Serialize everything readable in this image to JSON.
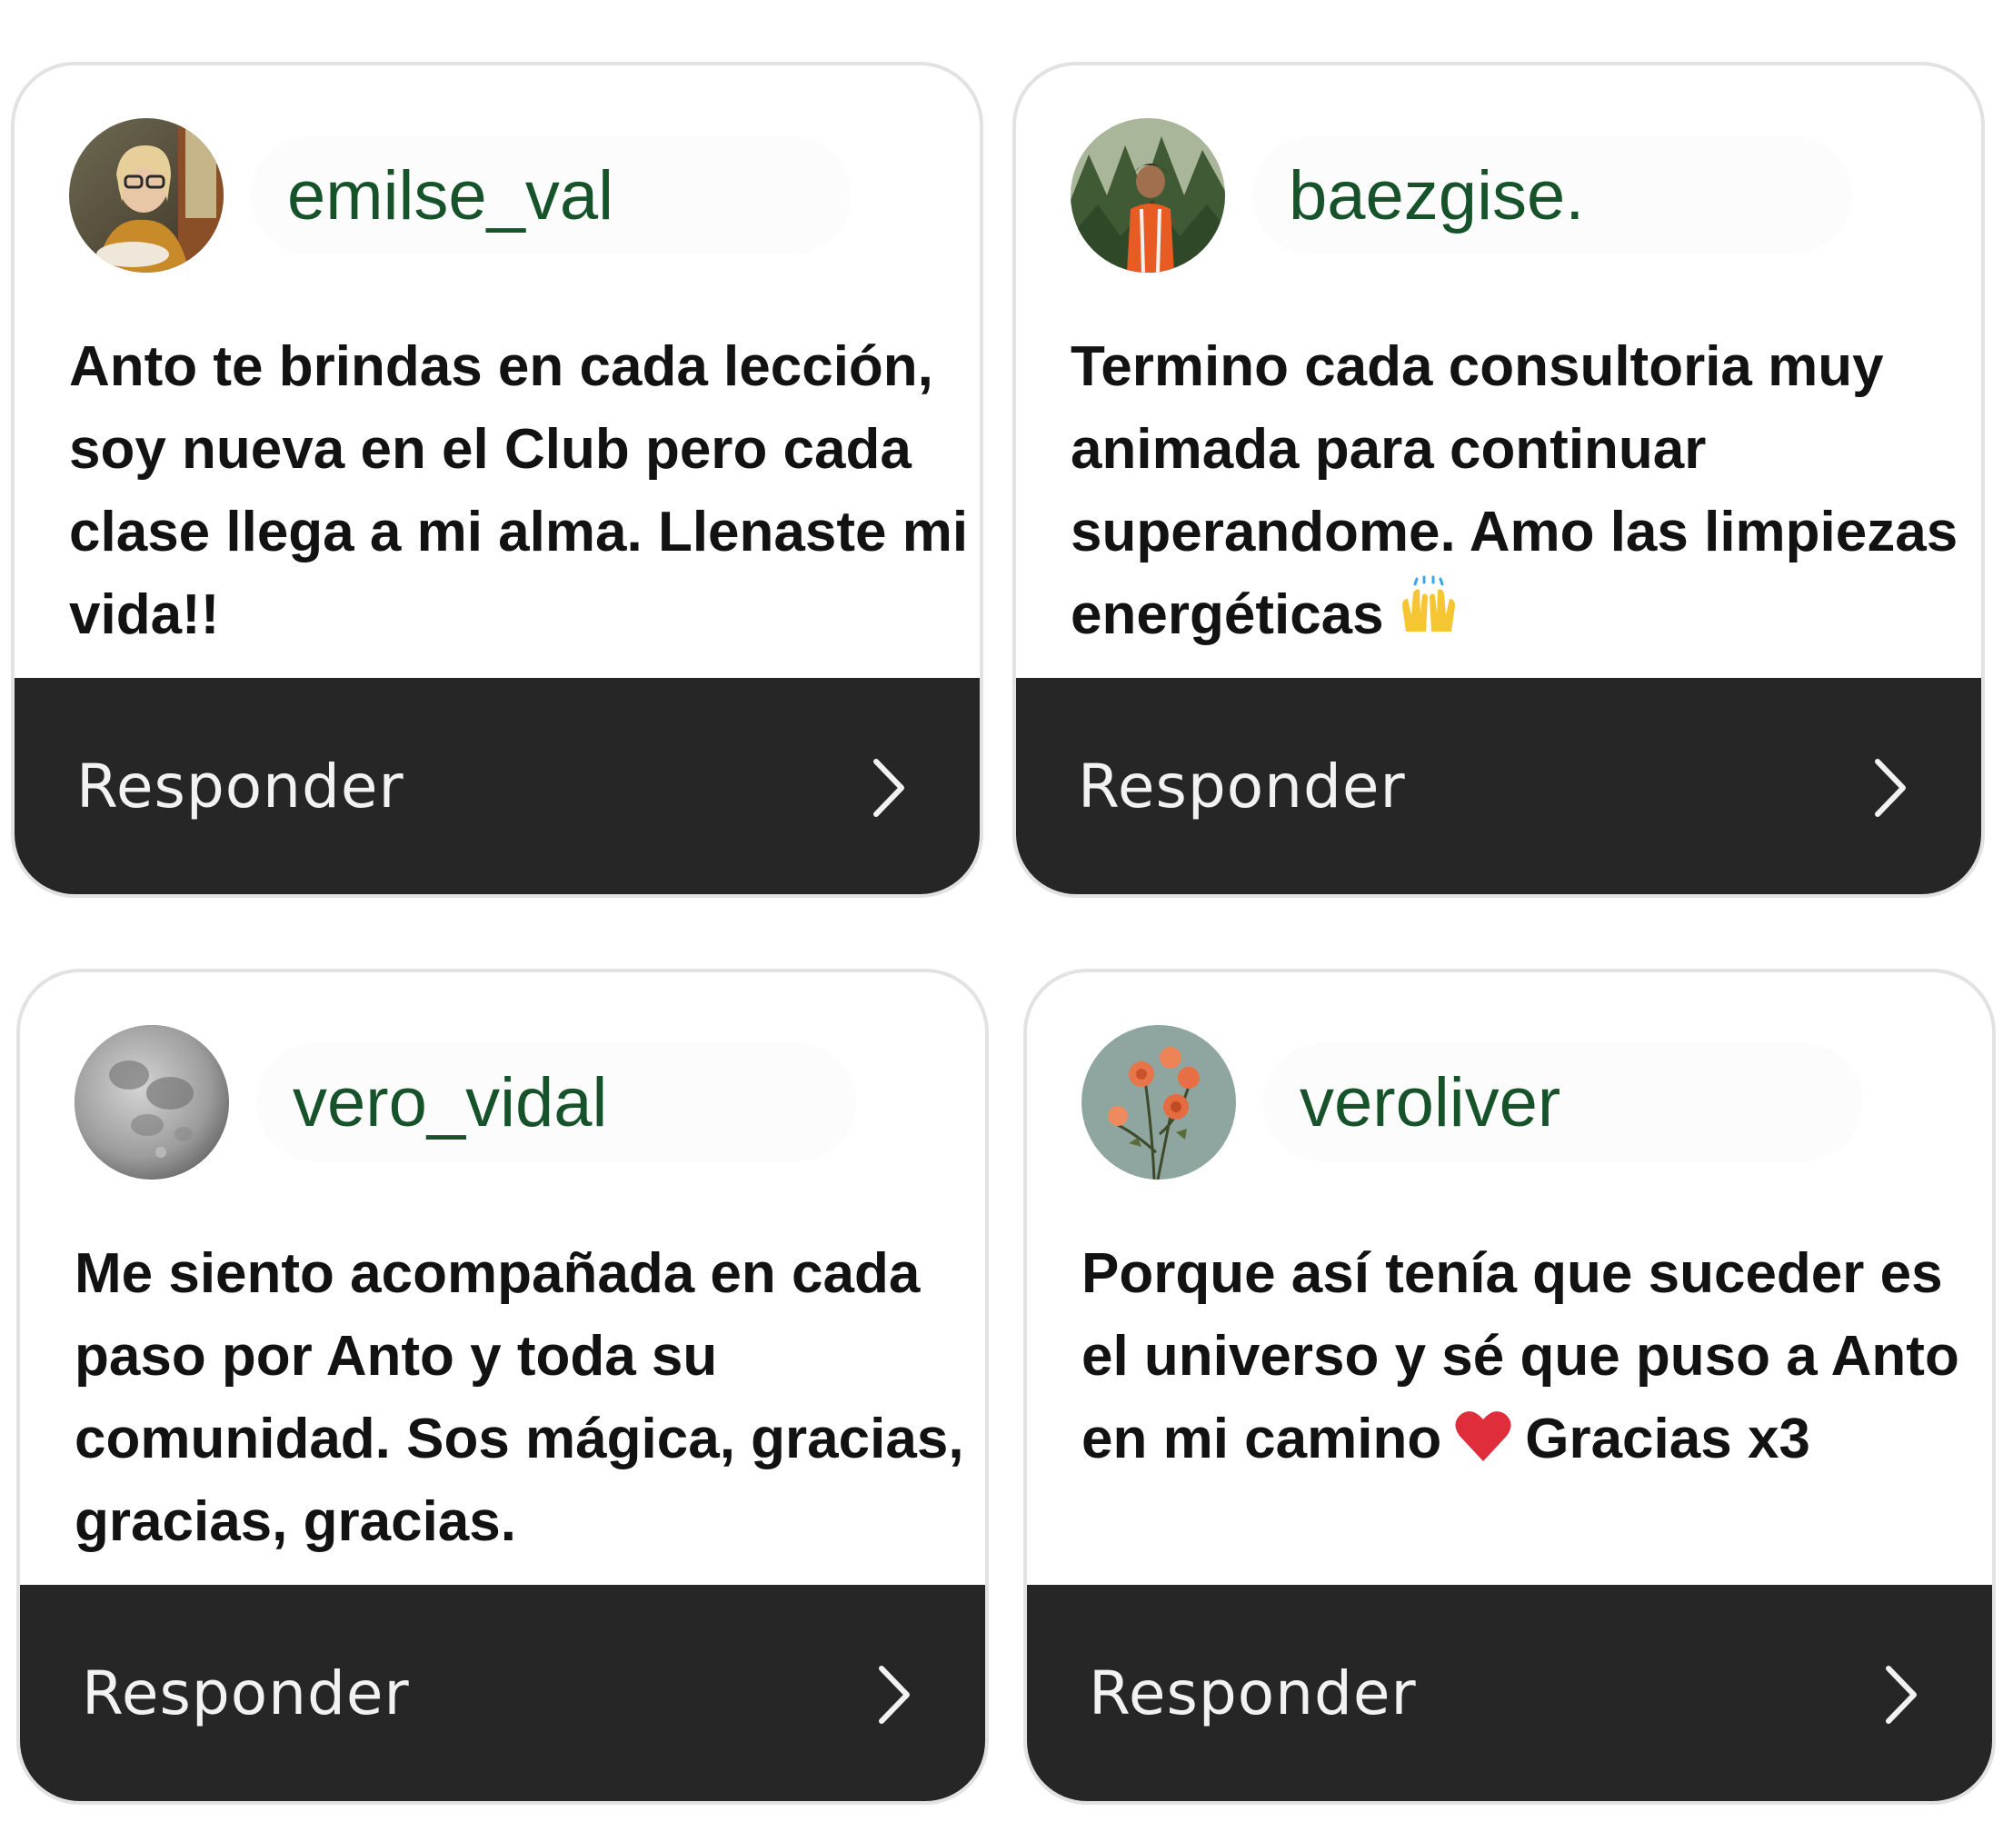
{
  "reply_label": "Responder",
  "colors": {
    "username": "#17532a",
    "reply_bar": "#262626",
    "card_border": "#e2e2e2"
  },
  "cards": [
    {
      "username": "emilse_val",
      "avatar": "woman-with-glasses-photo",
      "message": "Anto te brindas en cada lección, soy nueva en el Club pero cada clase llega a mi alma. Llenaste mi vida!!"
    },
    {
      "username": "baezgise.",
      "avatar": "person-in-forest-photo",
      "message": "Termino cada consultoria muy animada para continuar superandome. Amo las limpiezas energéticas",
      "emoji": "raising-hands-icon"
    },
    {
      "username": "vero_vidal",
      "avatar": "full-moon-photo",
      "message": "Me siento acompañada en cada paso por Anto y toda su comunidad. Sos mágica, gracias, gracias, gracias."
    },
    {
      "username": "veroliver",
      "avatar": "roses-photo",
      "message_before": "Porque así tenía que suceder es el universo y sé que puso a Anto en mi camino",
      "emoji": "red-heart-icon",
      "message_after": "Gracias x3"
    }
  ]
}
